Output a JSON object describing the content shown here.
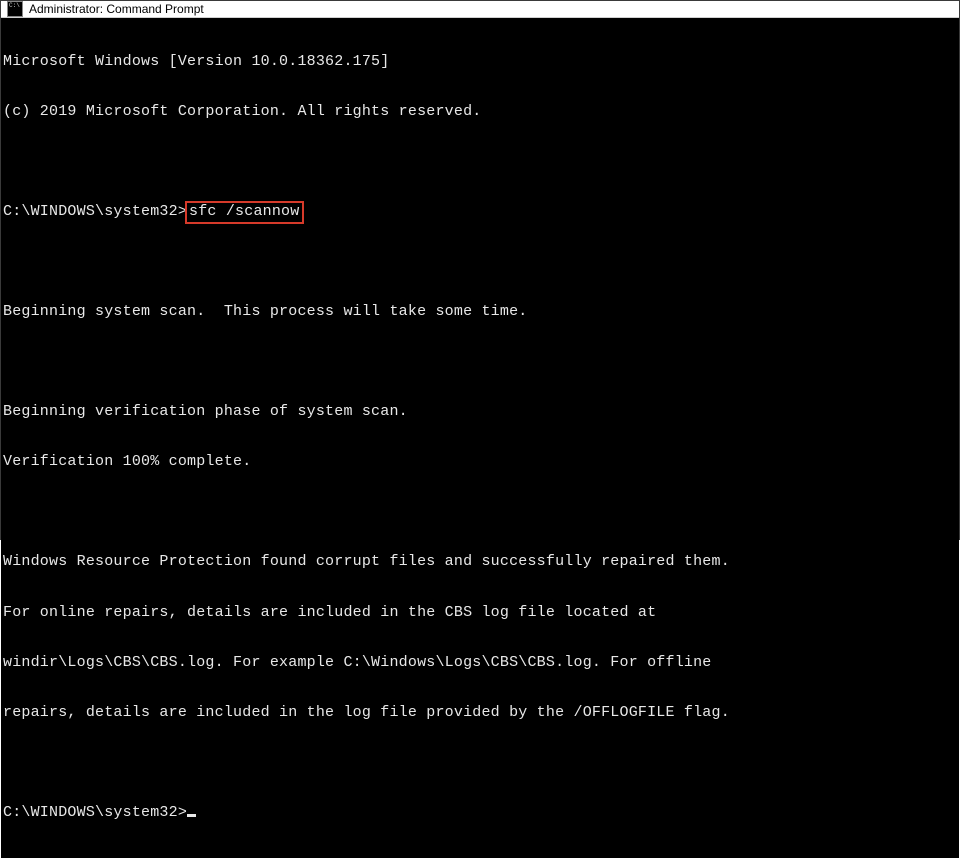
{
  "window": {
    "title": "Administrator: Command Prompt"
  },
  "console": {
    "lines": {
      "version": "Microsoft Windows [Version 10.0.18362.175]",
      "copyright": "(c) 2019 Microsoft Corporation. All rights reserved.",
      "prompt1": "C:\\WINDOWS\\system32>",
      "command1": "sfc /scannow",
      "begin_scan": "Beginning system scan.  This process will take some time.",
      "begin_verify": "Beginning verification phase of system scan.",
      "verify_complete": "Verification 100% complete.",
      "result1": "Windows Resource Protection found corrupt files and successfully repaired them.",
      "result2": "For online repairs, details are included in the CBS log file located at",
      "result3": "windir\\Logs\\CBS\\CBS.log. For example C:\\Windows\\Logs\\CBS\\CBS.log. For offline",
      "result4": "repairs, details are included in the log file provided by the /OFFLOGFILE flag.",
      "prompt2": "C:\\WINDOWS\\system32>"
    }
  },
  "highlight": {
    "color": "#d63a2a"
  }
}
